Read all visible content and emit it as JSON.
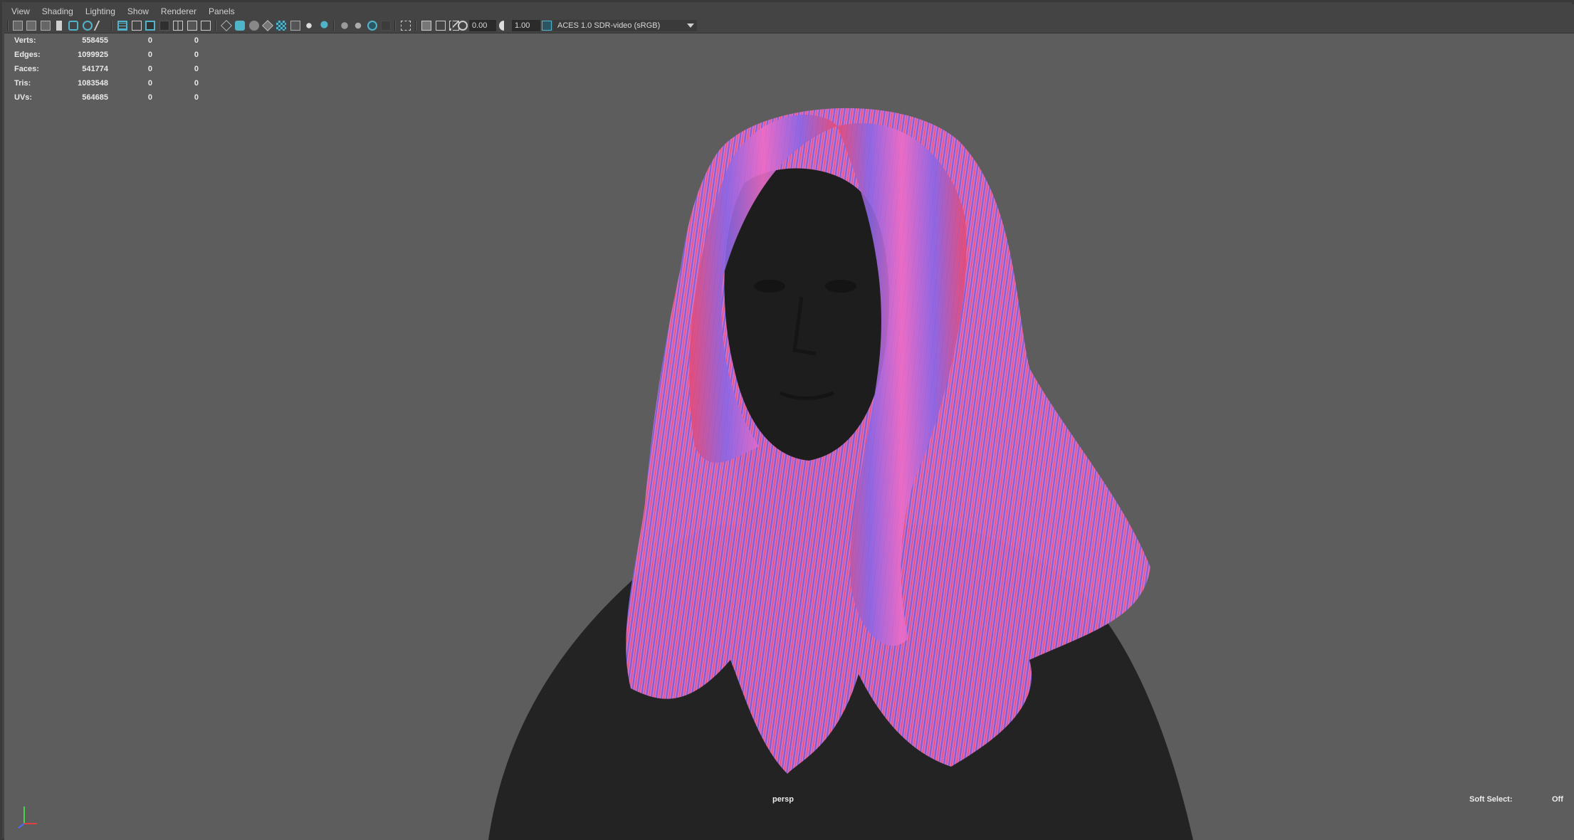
{
  "menu": [
    "View",
    "Shading",
    "Lighting",
    "Show",
    "Renderer",
    "Panels"
  ],
  "toolbar": {
    "exposure_value": "0.00",
    "gamma_value": "1.00",
    "color_space": "ACES 1.0 SDR-video (sRGB)",
    "icons": [
      "select-camera-icon",
      "camera-attributes-icon",
      "bookmarks-icon",
      "image-plane-icon",
      "grease-pencil-icon",
      "2d-pan-zoom-icon",
      "grid-icon",
      "film-gate-icon",
      "resolution-gate-icon",
      "gate-mask-icon",
      "field-chart-icon",
      "safe-action-icon",
      "safe-title-icon",
      "wireframe-icon",
      "smooth-shade-icon",
      "use-default-material-icon",
      "wireframe-on-shaded-icon",
      "xray-icon",
      "textured-icon",
      "lights-icon",
      "shadows-icon",
      "screen-space-ao-icon",
      "motion-blur-icon",
      "multisample-aa-icon",
      "depth-of-field-icon",
      "isolate-select-icon",
      "xray-joints-icon",
      "xray-active-icon",
      "backface-culling-icon",
      "exposure-icon",
      "gamma-icon",
      "color-management-icon"
    ]
  },
  "stats": [
    {
      "label": "Verts:",
      "v1": "558455",
      "v2": "0",
      "v3": "0"
    },
    {
      "label": "Edges:",
      "v1": "1099925",
      "v2": "0",
      "v3": "0"
    },
    {
      "label": "Faces:",
      "v1": "541774",
      "v2": "0",
      "v3": "0"
    },
    {
      "label": "Tris:",
      "v1": "1083548",
      "v2": "0",
      "v3": "0"
    },
    {
      "label": "UVs:",
      "v1": "564685",
      "v2": "0",
      "v3": "0"
    }
  ],
  "viewport": {
    "camera": "persp",
    "soft_select_label": "Soft Select:",
    "soft_select_value": "Off"
  },
  "colors": {
    "viewport_bg": "#5d5d5d",
    "hair_pink": "#e866c8",
    "hair_blue": "#7a62e0",
    "hair_red": "#e8405a",
    "body": "#222222"
  }
}
